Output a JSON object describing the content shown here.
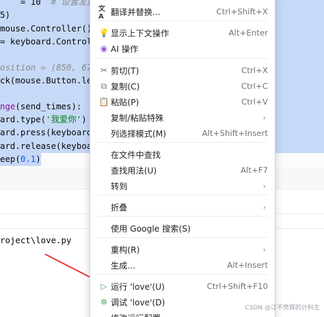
{
  "editor": {
    "lines": [
      {
        "parts": [
          {
            "t": "    = 10  ",
            "c": ""
          },
          {
            "t": "# 设置发送次数",
            "c": "c-gray"
          }
        ]
      },
      {
        "parts": [
          {
            "t": "5)",
            "c": ""
          }
        ]
      },
      {
        "parts": [
          {
            "t": "mouse.Controller()",
            "c": ""
          }
        ]
      },
      {
        "parts": [
          {
            "t": "= keyboard.Control",
            "c": ""
          }
        ]
      },
      {
        "parts": [
          {
            "t": "",
            "c": ""
          }
        ]
      },
      {
        "parts": [
          {
            "t": "osition = (850, 67",
            "c": "c-gray"
          }
        ]
      },
      {
        "parts": [
          {
            "t": "ck(mouse.Button.le",
            "c": ""
          }
        ]
      },
      {
        "parts": [
          {
            "t": "",
            "c": ""
          }
        ]
      },
      {
        "parts": [
          {
            "t": "nge",
            "c": "c-purple"
          },
          {
            "t": "(send_times):",
            "c": ""
          }
        ]
      },
      {
        "parts": [
          {
            "t": "ard.type(",
            "c": ""
          },
          {
            "t": "'我爱你'",
            "c": "c-green"
          },
          {
            "t": ")",
            "c": ""
          }
        ]
      },
      {
        "parts": [
          {
            "t": "ard.press(keyboard",
            "c": ""
          }
        ]
      },
      {
        "parts": [
          {
            "t": "ard.release(keyboa",
            "c": ""
          }
        ]
      },
      {
        "parts": [
          {
            "t": "eep(",
            "c": ""
          },
          {
            "t": "0.1",
            "c": "c-blue"
          },
          {
            "t": ")",
            "c": ""
          }
        ]
      }
    ],
    "path_text": "roject\\love.py"
  },
  "menu": {
    "items": [
      {
        "id": "translate",
        "icon": "translate-icon",
        "glyph": "文A",
        "label": "翻译并替换...",
        "shortcut": "Ctrl+Shift+X"
      },
      {
        "id": "context-actions",
        "icon": "lightbulb-icon",
        "glyph": "💡",
        "label": "显示上下文操作",
        "shortcut": "Alt+Enter"
      },
      {
        "id": "ai-actions",
        "icon": "ai-icon",
        "glyph": "◉",
        "label": "AI 操作",
        "shortcut": ""
      },
      {
        "id": "cut",
        "icon": "scissors-icon",
        "glyph": "✂",
        "label": "剪切(T)",
        "shortcut": "Ctrl+X"
      },
      {
        "id": "copy",
        "icon": "copy-icon",
        "glyph": "⧉",
        "label": "复制(C)",
        "shortcut": "Ctrl+C"
      },
      {
        "id": "paste",
        "icon": "paste-icon",
        "glyph": "📋",
        "label": "粘贴(P)",
        "shortcut": "Ctrl+V"
      },
      {
        "id": "copy-paste-special",
        "icon": "",
        "glyph": "",
        "label": "复制/粘贴特殊",
        "shortcut": "",
        "submenu": true
      },
      {
        "id": "column-selection",
        "icon": "",
        "glyph": "",
        "label": "列选择模式(M)",
        "shortcut": "Alt+Shift+Insert"
      },
      {
        "id": "find-in-files",
        "icon": "",
        "glyph": "",
        "label": "在文件中查找",
        "shortcut": ""
      },
      {
        "id": "find-usages",
        "icon": "",
        "glyph": "",
        "label": "查找用法(U)",
        "shortcut": "Alt+F7"
      },
      {
        "id": "goto",
        "icon": "",
        "glyph": "",
        "label": "转到",
        "shortcut": "",
        "submenu": true
      },
      {
        "id": "folding",
        "icon": "",
        "glyph": "",
        "label": "折叠",
        "shortcut": "",
        "submenu": true
      },
      {
        "id": "google-search",
        "icon": "",
        "glyph": "",
        "label": "使用 Google 搜索(S)",
        "shortcut": ""
      },
      {
        "id": "refactor",
        "icon": "",
        "glyph": "",
        "label": "重构(R)",
        "shortcut": "",
        "submenu": true
      },
      {
        "id": "generate",
        "icon": "",
        "glyph": "",
        "label": "生成...",
        "shortcut": "Alt+Insert"
      },
      {
        "id": "run",
        "icon": "run-icon",
        "glyph": "▷",
        "label": "运行 'love'(U)",
        "shortcut": "Ctrl+Shift+F10"
      },
      {
        "id": "debug",
        "icon": "debug-icon",
        "glyph": "✲",
        "label": "调试 'love'(D)",
        "shortcut": ""
      },
      {
        "id": "modify-run-config",
        "icon": "",
        "glyph": "",
        "label": "修改运行配置...",
        "shortcut": ""
      }
    ],
    "submenu_glyph": "›"
  },
  "colors": {
    "selection": "#c6d9f7",
    "run_icon": "#4da363",
    "debug_icon": "#4da363",
    "ai_icon": "#8c5fd9",
    "arrow": "#e23a3a"
  },
  "watermark": "CSDN @江不亮辉的计科生"
}
